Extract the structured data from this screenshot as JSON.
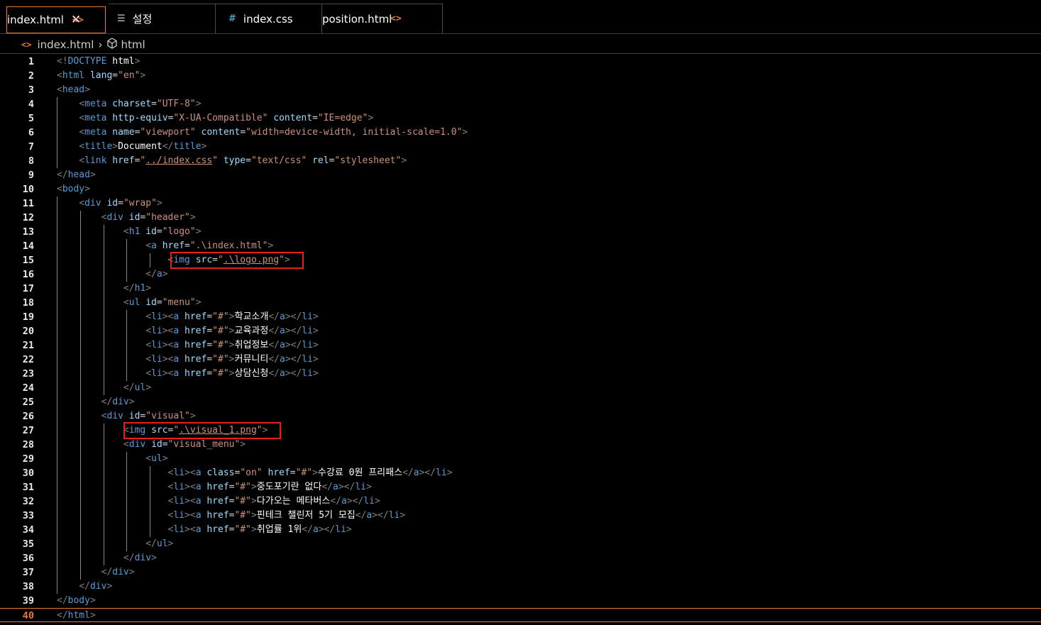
{
  "tabs": [
    {
      "label": "index.html",
      "icon": "html-code-icon",
      "active": true
    },
    {
      "label": "설정",
      "icon": "settings-list-icon",
      "active": false
    },
    {
      "label": "index.css",
      "icon": "css-hash-icon",
      "active": false
    },
    {
      "label": "position.html",
      "icon": "html-code-icon",
      "active": false
    }
  ],
  "breadcrumb": {
    "file": "index.html",
    "symbol": "html"
  },
  "current_line": 40,
  "lines": [
    [
      [
        "p",
        "<!"
      ],
      [
        "t",
        "DOCTYPE"
      ],
      [
        "x",
        " "
      ],
      [
        "k",
        "html"
      ],
      [
        "p",
        ">"
      ]
    ],
    [
      [
        "p",
        "<"
      ],
      [
        "t",
        "html"
      ],
      [
        "x",
        " "
      ],
      [
        "a",
        "lang"
      ],
      [
        "x",
        "="
      ],
      [
        "s",
        "\"en\""
      ],
      [
        "p",
        ">"
      ]
    ],
    [
      [
        "p",
        "<"
      ],
      [
        "t",
        "head"
      ],
      [
        "p",
        ">"
      ]
    ],
    [
      [
        "x",
        "    "
      ],
      [
        "p",
        "<"
      ],
      [
        "t",
        "meta"
      ],
      [
        "x",
        " "
      ],
      [
        "a",
        "charset"
      ],
      [
        "x",
        "="
      ],
      [
        "s",
        "\"UTF-8\""
      ],
      [
        "p",
        ">"
      ]
    ],
    [
      [
        "x",
        "    "
      ],
      [
        "p",
        "<"
      ],
      [
        "t",
        "meta"
      ],
      [
        "x",
        " "
      ],
      [
        "a",
        "http-equiv"
      ],
      [
        "x",
        "="
      ],
      [
        "s",
        "\"X-UA-Compatible\""
      ],
      [
        "x",
        " "
      ],
      [
        "a",
        "content"
      ],
      [
        "x",
        "="
      ],
      [
        "s",
        "\"IE=edge\""
      ],
      [
        "p",
        ">"
      ]
    ],
    [
      [
        "x",
        "    "
      ],
      [
        "p",
        "<"
      ],
      [
        "t",
        "meta"
      ],
      [
        "x",
        " "
      ],
      [
        "a",
        "name"
      ],
      [
        "x",
        "="
      ],
      [
        "s",
        "\"viewport\""
      ],
      [
        "x",
        " "
      ],
      [
        "a",
        "content"
      ],
      [
        "x",
        "="
      ],
      [
        "s",
        "\"width=device-width, initial-scale=1.0\""
      ],
      [
        "p",
        ">"
      ]
    ],
    [
      [
        "x",
        "    "
      ],
      [
        "p",
        "<"
      ],
      [
        "t",
        "title"
      ],
      [
        "p",
        ">"
      ],
      [
        "k",
        "Document"
      ],
      [
        "p",
        "</"
      ],
      [
        "t",
        "title"
      ],
      [
        "p",
        ">"
      ]
    ],
    [
      [
        "x",
        "    "
      ],
      [
        "p",
        "<"
      ],
      [
        "t",
        "link"
      ],
      [
        "x",
        " "
      ],
      [
        "a",
        "href"
      ],
      [
        "x",
        "="
      ],
      [
        "s",
        "\""
      ],
      [
        "su",
        "../index.css"
      ],
      [
        "s",
        "\""
      ],
      [
        "x",
        " "
      ],
      [
        "a",
        "type"
      ],
      [
        "x",
        "="
      ],
      [
        "s",
        "\"text/css\""
      ],
      [
        "x",
        " "
      ],
      [
        "a",
        "rel"
      ],
      [
        "x",
        "="
      ],
      [
        "s",
        "\"stylesheet\""
      ],
      [
        "p",
        ">"
      ]
    ],
    [
      [
        "p",
        "</"
      ],
      [
        "t",
        "head"
      ],
      [
        "p",
        ">"
      ]
    ],
    [
      [
        "p",
        "<"
      ],
      [
        "t",
        "body"
      ],
      [
        "p",
        ">"
      ]
    ],
    [
      [
        "x",
        "    "
      ],
      [
        "p",
        "<"
      ],
      [
        "t",
        "div"
      ],
      [
        "x",
        " "
      ],
      [
        "a",
        "id"
      ],
      [
        "x",
        "="
      ],
      [
        "s",
        "\"wrap\""
      ],
      [
        "p",
        ">"
      ]
    ],
    [
      [
        "x",
        "        "
      ],
      [
        "p",
        "<"
      ],
      [
        "t",
        "div"
      ],
      [
        "x",
        " "
      ],
      [
        "a",
        "id"
      ],
      [
        "x",
        "="
      ],
      [
        "s",
        "\"header\""
      ],
      [
        "p",
        ">"
      ]
    ],
    [
      [
        "x",
        "            "
      ],
      [
        "p",
        "<"
      ],
      [
        "t",
        "h1"
      ],
      [
        "x",
        " "
      ],
      [
        "a",
        "id"
      ],
      [
        "x",
        "="
      ],
      [
        "s",
        "\"logo\""
      ],
      [
        "p",
        ">"
      ]
    ],
    [
      [
        "x",
        "                "
      ],
      [
        "p",
        "<"
      ],
      [
        "t",
        "a"
      ],
      [
        "x",
        " "
      ],
      [
        "a",
        "href"
      ],
      [
        "x",
        "="
      ],
      [
        "s",
        "\".\\index.html\""
      ],
      [
        "p",
        ">"
      ]
    ],
    [
      [
        "x",
        "                    "
      ],
      [
        "p",
        "<"
      ],
      [
        "t",
        "img"
      ],
      [
        "x",
        " "
      ],
      [
        "a",
        "src"
      ],
      [
        "x",
        "="
      ],
      [
        "s",
        "\""
      ],
      [
        "su",
        ".\\logo.png"
      ],
      [
        "s",
        "\""
      ],
      [
        "p",
        ">"
      ]
    ],
    [
      [
        "x",
        "                "
      ],
      [
        "p",
        "</"
      ],
      [
        "t",
        "a"
      ],
      [
        "p",
        ">"
      ]
    ],
    [
      [
        "x",
        "            "
      ],
      [
        "p",
        "</"
      ],
      [
        "t",
        "h1"
      ],
      [
        "p",
        ">"
      ]
    ],
    [
      [
        "x",
        "            "
      ],
      [
        "p",
        "<"
      ],
      [
        "t",
        "ul"
      ],
      [
        "x",
        " "
      ],
      [
        "a",
        "id"
      ],
      [
        "x",
        "="
      ],
      [
        "s",
        "\"menu\""
      ],
      [
        "p",
        ">"
      ]
    ],
    [
      [
        "x",
        "                "
      ],
      [
        "p",
        "<"
      ],
      [
        "t",
        "li"
      ],
      [
        "p",
        "><"
      ],
      [
        "t",
        "a"
      ],
      [
        "x",
        " "
      ],
      [
        "a",
        "href"
      ],
      [
        "x",
        "="
      ],
      [
        "s",
        "\"#\""
      ],
      [
        "p",
        ">"
      ],
      [
        "k",
        "학교소개"
      ],
      [
        "p",
        "</"
      ],
      [
        "t",
        "a"
      ],
      [
        "p",
        "></"
      ],
      [
        "t",
        "li"
      ],
      [
        "p",
        ">"
      ]
    ],
    [
      [
        "x",
        "                "
      ],
      [
        "p",
        "<"
      ],
      [
        "t",
        "li"
      ],
      [
        "p",
        "><"
      ],
      [
        "t",
        "a"
      ],
      [
        "x",
        " "
      ],
      [
        "a",
        "href"
      ],
      [
        "x",
        "="
      ],
      [
        "s",
        "\"#\""
      ],
      [
        "p",
        ">"
      ],
      [
        "k",
        "교육과정"
      ],
      [
        "p",
        "</"
      ],
      [
        "t",
        "a"
      ],
      [
        "p",
        "></"
      ],
      [
        "t",
        "li"
      ],
      [
        "p",
        ">"
      ]
    ],
    [
      [
        "x",
        "                "
      ],
      [
        "p",
        "<"
      ],
      [
        "t",
        "li"
      ],
      [
        "p",
        "><"
      ],
      [
        "t",
        "a"
      ],
      [
        "x",
        " "
      ],
      [
        "a",
        "href"
      ],
      [
        "x",
        "="
      ],
      [
        "s",
        "\"#\""
      ],
      [
        "p",
        ">"
      ],
      [
        "k",
        "취업정보"
      ],
      [
        "p",
        "</"
      ],
      [
        "t",
        "a"
      ],
      [
        "p",
        "></"
      ],
      [
        "t",
        "li"
      ],
      [
        "p",
        ">"
      ]
    ],
    [
      [
        "x",
        "                "
      ],
      [
        "p",
        "<"
      ],
      [
        "t",
        "li"
      ],
      [
        "p",
        "><"
      ],
      [
        "t",
        "a"
      ],
      [
        "x",
        " "
      ],
      [
        "a",
        "href"
      ],
      [
        "x",
        "="
      ],
      [
        "s",
        "\"#\""
      ],
      [
        "p",
        ">"
      ],
      [
        "k",
        "커뮤니티"
      ],
      [
        "p",
        "</"
      ],
      [
        "t",
        "a"
      ],
      [
        "p",
        "></"
      ],
      [
        "t",
        "li"
      ],
      [
        "p",
        ">"
      ]
    ],
    [
      [
        "x",
        "                "
      ],
      [
        "p",
        "<"
      ],
      [
        "t",
        "li"
      ],
      [
        "p",
        "><"
      ],
      [
        "t",
        "a"
      ],
      [
        "x",
        " "
      ],
      [
        "a",
        "href"
      ],
      [
        "x",
        "="
      ],
      [
        "s",
        "\"#\""
      ],
      [
        "p",
        ">"
      ],
      [
        "k",
        "상담신청"
      ],
      [
        "p",
        "</"
      ],
      [
        "t",
        "a"
      ],
      [
        "p",
        "></"
      ],
      [
        "t",
        "li"
      ],
      [
        "p",
        ">"
      ]
    ],
    [
      [
        "x",
        "            "
      ],
      [
        "p",
        "</"
      ],
      [
        "t",
        "ul"
      ],
      [
        "p",
        ">"
      ]
    ],
    [
      [
        "x",
        "        "
      ],
      [
        "p",
        "</"
      ],
      [
        "t",
        "div"
      ],
      [
        "p",
        ">"
      ]
    ],
    [
      [
        "x",
        "        "
      ],
      [
        "p",
        "<"
      ],
      [
        "t",
        "div"
      ],
      [
        "x",
        " "
      ],
      [
        "a",
        "id"
      ],
      [
        "x",
        "="
      ],
      [
        "s",
        "\"visual\""
      ],
      [
        "p",
        ">"
      ]
    ],
    [
      [
        "x",
        "            "
      ],
      [
        "p",
        "<"
      ],
      [
        "t",
        "img"
      ],
      [
        "x",
        " "
      ],
      [
        "a",
        "src"
      ],
      [
        "x",
        "="
      ],
      [
        "s",
        "\""
      ],
      [
        "su",
        ".\\visual_1.png"
      ],
      [
        "s",
        "\""
      ],
      [
        "p",
        ">"
      ]
    ],
    [
      [
        "x",
        "            "
      ],
      [
        "p",
        "<"
      ],
      [
        "t",
        "div"
      ],
      [
        "x",
        " "
      ],
      [
        "a",
        "id"
      ],
      [
        "x",
        "="
      ],
      [
        "s",
        "\"visual_menu\""
      ],
      [
        "p",
        ">"
      ]
    ],
    [
      [
        "x",
        "                "
      ],
      [
        "p",
        "<"
      ],
      [
        "t",
        "ul"
      ],
      [
        "p",
        ">"
      ]
    ],
    [
      [
        "x",
        "                    "
      ],
      [
        "p",
        "<"
      ],
      [
        "t",
        "li"
      ],
      [
        "p",
        "><"
      ],
      [
        "t",
        "a"
      ],
      [
        "x",
        " "
      ],
      [
        "a",
        "class"
      ],
      [
        "x",
        "="
      ],
      [
        "s",
        "\"on\""
      ],
      [
        "x",
        " "
      ],
      [
        "a",
        "href"
      ],
      [
        "x",
        "="
      ],
      [
        "s",
        "\"#\""
      ],
      [
        "p",
        ">"
      ],
      [
        "k",
        "수강료 0원 프리패스"
      ],
      [
        "p",
        "</"
      ],
      [
        "t",
        "a"
      ],
      [
        "p",
        "></"
      ],
      [
        "t",
        "li"
      ],
      [
        "p",
        ">"
      ]
    ],
    [
      [
        "x",
        "                    "
      ],
      [
        "p",
        "<"
      ],
      [
        "t",
        "li"
      ],
      [
        "p",
        "><"
      ],
      [
        "t",
        "a"
      ],
      [
        "x",
        " "
      ],
      [
        "a",
        "href"
      ],
      [
        "x",
        "="
      ],
      [
        "s",
        "\"#\""
      ],
      [
        "p",
        ">"
      ],
      [
        "k",
        "중도포기란 없다"
      ],
      [
        "p",
        "</"
      ],
      [
        "t",
        "a"
      ],
      [
        "p",
        "></"
      ],
      [
        "t",
        "li"
      ],
      [
        "p",
        ">"
      ]
    ],
    [
      [
        "x",
        "                    "
      ],
      [
        "p",
        "<"
      ],
      [
        "t",
        "li"
      ],
      [
        "p",
        "><"
      ],
      [
        "t",
        "a"
      ],
      [
        "x",
        " "
      ],
      [
        "a",
        "href"
      ],
      [
        "x",
        "="
      ],
      [
        "s",
        "\"#\""
      ],
      [
        "p",
        ">"
      ],
      [
        "k",
        "다가오는 메타버스"
      ],
      [
        "p",
        "</"
      ],
      [
        "t",
        "a"
      ],
      [
        "p",
        "></"
      ],
      [
        "t",
        "li"
      ],
      [
        "p",
        ">"
      ]
    ],
    [
      [
        "x",
        "                    "
      ],
      [
        "p",
        "<"
      ],
      [
        "t",
        "li"
      ],
      [
        "p",
        "><"
      ],
      [
        "t",
        "a"
      ],
      [
        "x",
        " "
      ],
      [
        "a",
        "href"
      ],
      [
        "x",
        "="
      ],
      [
        "s",
        "\"#\""
      ],
      [
        "p",
        ">"
      ],
      [
        "k",
        "핀테크 챌린저 5기 모집"
      ],
      [
        "p",
        "</"
      ],
      [
        "t",
        "a"
      ],
      [
        "p",
        "></"
      ],
      [
        "t",
        "li"
      ],
      [
        "p",
        ">"
      ]
    ],
    [
      [
        "x",
        "                    "
      ],
      [
        "p",
        "<"
      ],
      [
        "t",
        "li"
      ],
      [
        "p",
        "><"
      ],
      [
        "t",
        "a"
      ],
      [
        "x",
        " "
      ],
      [
        "a",
        "href"
      ],
      [
        "x",
        "="
      ],
      [
        "s",
        "\"#\""
      ],
      [
        "p",
        ">"
      ],
      [
        "k",
        "취업률 1위"
      ],
      [
        "p",
        "</"
      ],
      [
        "t",
        "a"
      ],
      [
        "p",
        "></"
      ],
      [
        "t",
        "li"
      ],
      [
        "p",
        ">"
      ]
    ],
    [
      [
        "x",
        "                "
      ],
      [
        "p",
        "</"
      ],
      [
        "t",
        "ul"
      ],
      [
        "p",
        ">"
      ]
    ],
    [
      [
        "x",
        "            "
      ],
      [
        "p",
        "</"
      ],
      [
        "t",
        "div"
      ],
      [
        "p",
        ">"
      ]
    ],
    [
      [
        "x",
        "        "
      ],
      [
        "p",
        "</"
      ],
      [
        "t",
        "div"
      ],
      [
        "p",
        ">"
      ]
    ],
    [
      [
        "x",
        "    "
      ],
      [
        "p",
        "</"
      ],
      [
        "t",
        "div"
      ],
      [
        "p",
        ">"
      ]
    ],
    [
      [
        "p",
        "</"
      ],
      [
        "t",
        "body"
      ],
      [
        "p",
        ">"
      ]
    ],
    [
      [
        "p",
        "</"
      ],
      [
        "t",
        "html"
      ],
      [
        "p",
        ">"
      ]
    ]
  ],
  "highlighted_lines": [
    15,
    27
  ],
  "colors": {
    "accent": "#e07b39",
    "highlight_box": "#e51f1f",
    "tag": "#569cd6",
    "attribute": "#9cdcfe",
    "string": "#ce9178",
    "punctuation": "#808080",
    "background": "#000000"
  }
}
